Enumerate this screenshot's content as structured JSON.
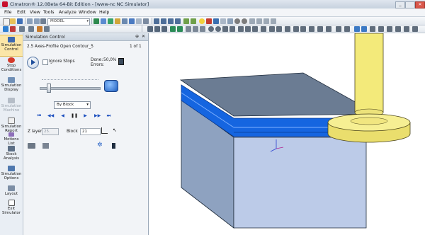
{
  "window": {
    "title": "Cimatron® 12.0Beta 64-Bit Edition - [www-nc NC Simulator]"
  },
  "menu": [
    "File",
    "Edit",
    "View",
    "Tools",
    "Analyze",
    "Window",
    "Help"
  ],
  "toolbar": {
    "model_combo": "MODEL"
  },
  "sidebar": {
    "items": [
      {
        "label": "Simulation Control"
      },
      {
        "label": "Stop Conditions"
      },
      {
        "label": "Simulation Display"
      },
      {
        "label": "Simulation Machine"
      },
      {
        "label": "Simulation Report"
      },
      {
        "label": "Motions List"
      },
      {
        "label": "Stock Analysis"
      },
      {
        "label": "Simulation Options"
      },
      {
        "label": "Layout"
      },
      {
        "label": "Exit Simulator"
      }
    ]
  },
  "panel": {
    "title": "Simulation Control",
    "procedure": "2.5 Axes-Profile Open Contour_5",
    "procedure_count": "1 of 1",
    "ignore_stops_label": "Ignore Stops",
    "done_label": "Done:",
    "done_value": "50,0%",
    "errors_label": "Errors:",
    "speed_fraction": 0.12,
    "step_mode": "By Block",
    "z_layer_label": "Z layer",
    "z_layer_value": "25.",
    "block_label": "Block",
    "block_value": "21"
  },
  "colors": {
    "accent": "#1e6fd9",
    "stock_top": "#6b7c93",
    "stock_side": "#b7c7e6",
    "cut_blue": "#1565e0",
    "spindle": "#f3ea7a",
    "active_tab": "#fbe6a8"
  },
  "icons": {
    "ctrl": [
      "first-icon",
      "step-back-icon",
      "rewind-icon",
      "pause-icon",
      "play-icon",
      "step-forward-icon",
      "last-icon"
    ]
  }
}
